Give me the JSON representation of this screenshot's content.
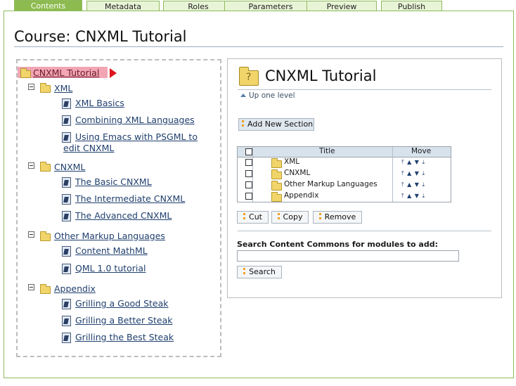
{
  "tabs": [
    {
      "label": "Contents",
      "active": true
    },
    {
      "label": "Metadata"
    },
    {
      "label": "Roles"
    },
    {
      "label": "Parameters"
    },
    {
      "label": "Preview"
    },
    {
      "label": "Publish"
    }
  ],
  "page_title": "Course: CNXML Tutorial",
  "tree": {
    "root": "CNXML Tutorial",
    "groups": [
      {
        "label": "XML",
        "items": [
          "XML Basics",
          "Combining XML Languages",
          "Using Emacs with PSGML to",
          "edit CNXML"
        ]
      },
      {
        "label": "CNXML",
        "items": [
          "The Basic CNXML",
          "The Intermediate CNXML",
          "The Advanced CNXML"
        ]
      },
      {
        "label": "Other Markup Languages",
        "items": [
          "Content MathML",
          "QML 1.0 tutorial"
        ]
      },
      {
        "label": "Appendix",
        "items": [
          "Grilling a Good Steak",
          "Grilling a Better Steak",
          "Grilling the Best Steak"
        ]
      }
    ]
  },
  "panel": {
    "title": "CNXML Tutorial",
    "up_level": "Up one level",
    "add_section": "Add New Section",
    "table": {
      "col_title": "Title",
      "col_move": "Move",
      "rows": [
        "XML",
        "CNXML",
        "Other Markup Languages",
        "Appendix"
      ]
    },
    "buttons": {
      "cut": "Cut",
      "copy": "Copy",
      "remove": "Remove"
    },
    "search_label": "Search Content Commons for modules to add:",
    "search_value": "",
    "search_button": "Search"
  },
  "colors": {
    "accent_green": "#8dbb4f",
    "root_highlight": "#f2a6b4",
    "link": "#1f3f6e"
  }
}
